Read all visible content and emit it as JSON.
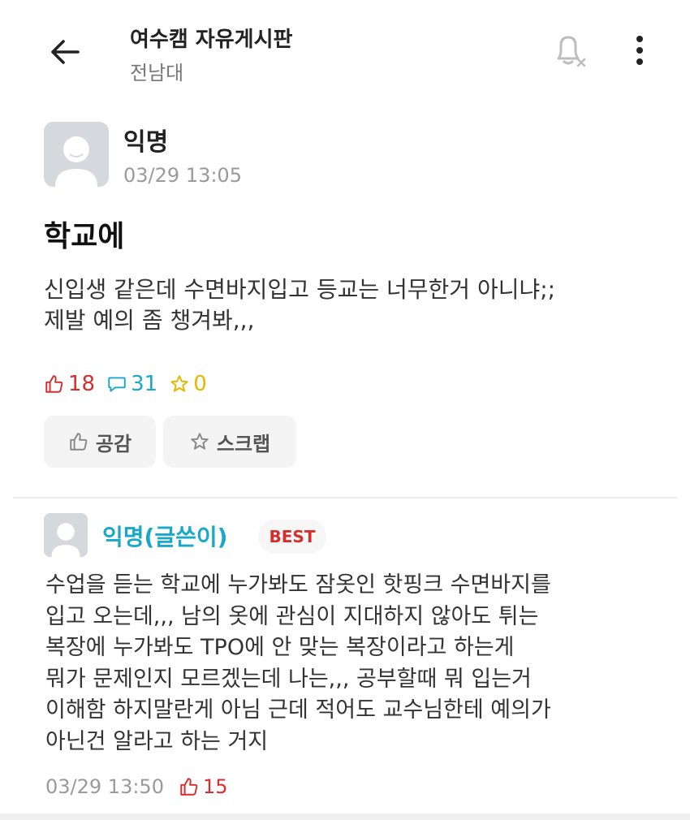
{
  "header": {
    "board_title": "여수캠 자유게시판",
    "board_sub": "전남대",
    "icons": {
      "back": "arrow-left-icon",
      "notify": "bell-off-icon",
      "more": "more-vertical-icon"
    }
  },
  "post": {
    "author": "익명",
    "time": "03/29 13:05",
    "title": "학교에",
    "body_lines": [
      "신입생 같은데 수면바지입고 등교는 너무한거 아니냐;;",
      "제발 예의 좀 챙겨봐,,,"
    ],
    "likes": "18",
    "comments": "31",
    "scraps": "0",
    "like_button": "공감",
    "scrap_button": "스크랩"
  },
  "comment": {
    "author": "익명(글쓴이)",
    "badge": "BEST",
    "body_lines": [
      "수업을 듣는 학교에 누가봐도 잠옷인 핫핑크 수면바지를",
      "입고 오는데,,, 남의 옷에 관심이 지대하지 않아도 튀는",
      "복장에 누가봐도 TPO에 안 맞는 복장이라고 하는게",
      "뭐가 문제인지 모르겠는데 나는,,, 공부할때 뭐 입는거",
      "이해함 하지말란게 아님 근데 적어도 교수님한테 예의가",
      "아닌건 알라고 하는 거지"
    ],
    "time": "03/29 13:50",
    "likes": "15"
  },
  "colors": {
    "like": "#d32f2f",
    "comment": "#1aa8c8",
    "scrap": "#e8b600",
    "author_comment": "#1aa8c8"
  }
}
